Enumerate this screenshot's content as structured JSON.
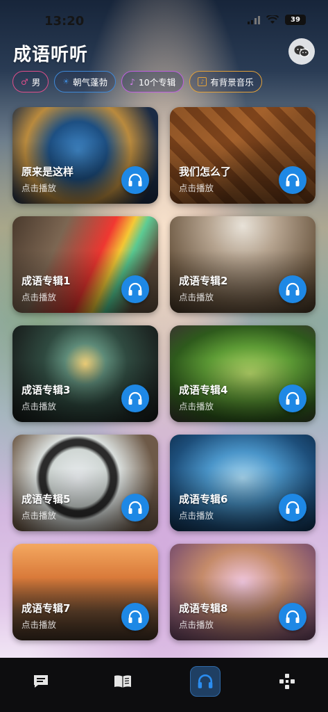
{
  "status": {
    "time": "13:20",
    "battery": "39"
  },
  "header": {
    "title": "成语听听"
  },
  "tags": [
    {
      "label": "男",
      "icon": "male-icon",
      "color": "#e04f8b"
    },
    {
      "label": "朝气蓬勃",
      "icon": "sun-icon",
      "color": "#3f89d8"
    },
    {
      "label": "10个专辑",
      "icon": "music-note-icon",
      "color": "#c060e0"
    },
    {
      "label": "有背景音乐",
      "icon": "music-box-icon",
      "color": "#e4a23a"
    }
  ],
  "albums": [
    {
      "title": "原来是这样",
      "subtitle": "点击播放"
    },
    {
      "title": "我们怎么了",
      "subtitle": "点击播放"
    },
    {
      "title": "成语专辑1",
      "subtitle": "点击播放"
    },
    {
      "title": "成语专辑2",
      "subtitle": "点击播放"
    },
    {
      "title": "成语专辑3",
      "subtitle": "点击播放"
    },
    {
      "title": "成语专辑4",
      "subtitle": "点击播放"
    },
    {
      "title": "成语专辑5",
      "subtitle": "点击播放"
    },
    {
      "title": "成语专辑6",
      "subtitle": "点击播放"
    },
    {
      "title": "成语专辑7",
      "subtitle": "点击播放"
    },
    {
      "title": "成语专辑8",
      "subtitle": "点击播放"
    }
  ],
  "nav": [
    {
      "name": "chat-icon",
      "active": false
    },
    {
      "name": "book-icon",
      "active": false
    },
    {
      "name": "headphones-icon",
      "active": true
    },
    {
      "name": "gamepad-icon",
      "active": false
    }
  ],
  "colors": {
    "accent": "#1e88e5",
    "nav_bg": "#0d0d0f"
  }
}
